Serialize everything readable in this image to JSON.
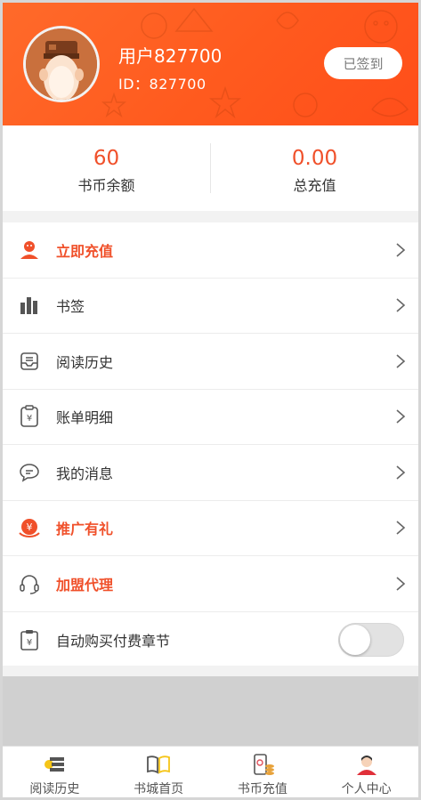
{
  "user": {
    "name": "用户827700",
    "id_text": "ID：827700",
    "sign_button": "已签到"
  },
  "stats": [
    {
      "value": "60",
      "label": "书币余额"
    },
    {
      "value": "0.00",
      "label": "总充值"
    }
  ],
  "menu": [
    {
      "label": "立即充值",
      "icon": "person-icon",
      "highlight": true
    },
    {
      "label": "书签",
      "icon": "books-icon",
      "highlight": false
    },
    {
      "label": "阅读历史",
      "icon": "history-tray-icon",
      "highlight": false
    },
    {
      "label": "账单明细",
      "icon": "bill-icon",
      "highlight": false
    },
    {
      "label": "我的消息",
      "icon": "message-icon",
      "highlight": false
    },
    {
      "label": "推广有礼",
      "icon": "money-bag-icon",
      "highlight": true
    },
    {
      "label": "加盟代理",
      "icon": "headset-icon",
      "highlight": true
    },
    {
      "label": "自动购买付费章节",
      "icon": "clipboard-yen-icon",
      "highlight": false
    }
  ],
  "auto_buy_enabled": false,
  "tabs": [
    {
      "label": "阅读历史",
      "icon": "reading-history-icon"
    },
    {
      "label": "书城首页",
      "icon": "open-book-icon"
    },
    {
      "label": "书币充值",
      "icon": "coin-phone-icon"
    },
    {
      "label": "个人中心",
      "icon": "user-avatar-icon"
    }
  ],
  "colors": {
    "accent": "#f0502a",
    "header": "#ff5a1e"
  }
}
